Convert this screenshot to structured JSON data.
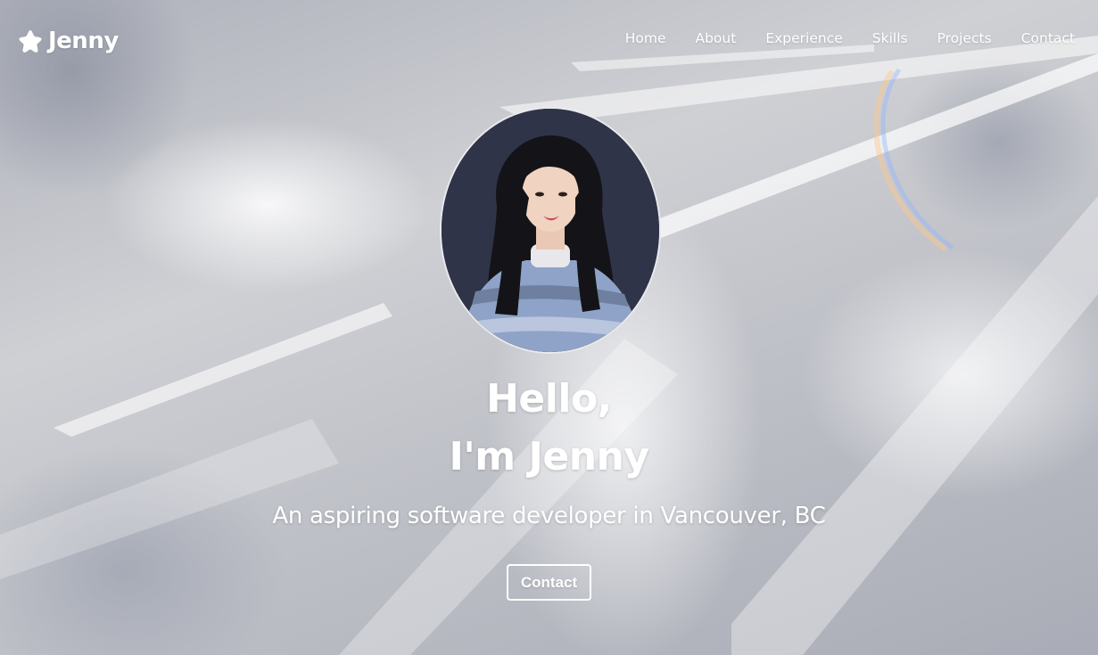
{
  "brand": {
    "name": "Jenny",
    "logo_icon": "flower-star-icon"
  },
  "nav": {
    "items": [
      {
        "label": "Home"
      },
      {
        "label": "About"
      },
      {
        "label": "Experience"
      },
      {
        "label": "Skills"
      },
      {
        "label": "Projects"
      },
      {
        "label": "Contact"
      }
    ]
  },
  "hero": {
    "greeting_line1": "Hello,",
    "greeting_line2": "I'm Jenny",
    "tagline": "An aspiring software developer in Vancouver, BC",
    "cta_label": "Contact"
  },
  "colors": {
    "text": "#ffffff",
    "avatar_background": "#2f3448",
    "sweater": "#8fa3c8"
  }
}
